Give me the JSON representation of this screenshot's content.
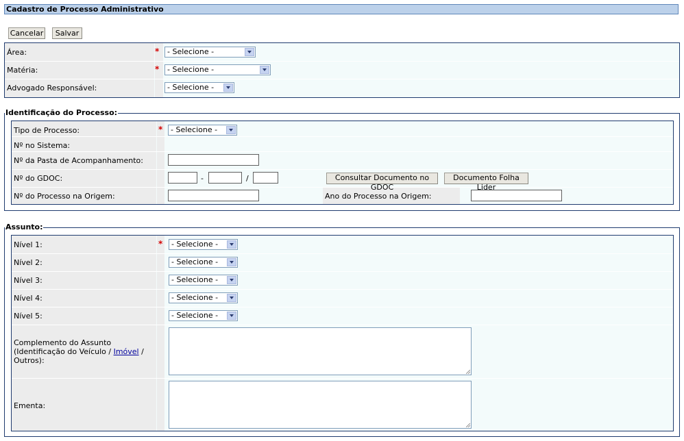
{
  "title": "Cadastro de Processo Administrativo",
  "toolbar": {
    "cancel_label": "Cancelar",
    "save_label": "Salvar"
  },
  "general": {
    "area_label": "Área:",
    "materia_label": "Matéria:",
    "advogado_label": "Advogado Responsável:",
    "select_default": "- Selecione -"
  },
  "identificacao": {
    "legend": "Identificação do Processo:",
    "tipo_label": "Tipo de Processo:",
    "sistema_label": "Nº no Sistema:",
    "pasta_label": "Nº da Pasta de Acompanhamento:",
    "gdoc_label": "Nº do GDOC:",
    "gdoc_sep1": "-",
    "gdoc_sep2": "/",
    "consultar_label": "Consultar Documento no GDOC",
    "folha_label": "Documento Folha Lider",
    "origem_label": "Nº do Processo na Origem:",
    "ano_label": "Ano do Processo na Origem:"
  },
  "assunto": {
    "legend": "Assunto:",
    "nivel1": "Nível 1:",
    "nivel2": "Nível 2:",
    "nivel3": "Nível 3:",
    "nivel4": "Nível 4:",
    "nivel5": "Nível 5:",
    "complemento_line1": "Complemento do Assunto",
    "complemento_line2a": "(Identificação do Veículo / ",
    "complemento_link": "Imóvel",
    "complemento_line2b": " /",
    "complemento_line3": "Outros):",
    "ementa_label": "Ementa:"
  },
  "required_mark": "*"
}
